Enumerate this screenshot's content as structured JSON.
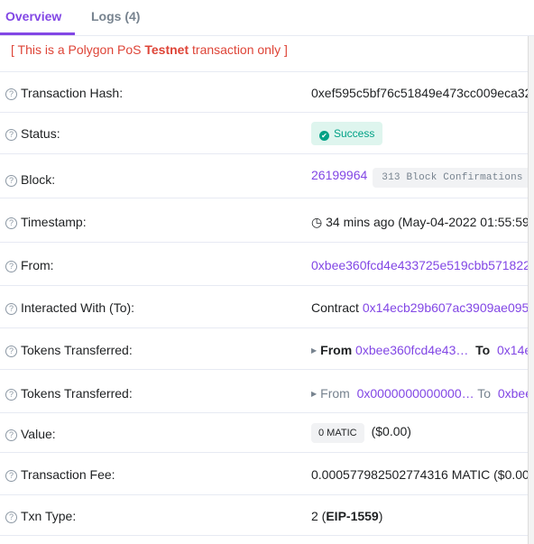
{
  "tabs": {
    "overview": "Overview",
    "logs": "Logs (4)"
  },
  "banner": {
    "prefix": "[ This is a Polygon PoS ",
    "bold": "Testnet",
    "suffix": " transaction only ]"
  },
  "help_glyph": "?",
  "rows": {
    "hash": {
      "label": "Transaction Hash:",
      "value": "0xef595c5bf76c51849e473cc009eca32"
    },
    "status": {
      "label": "Status:",
      "value": "Success"
    },
    "block": {
      "label": "Block:",
      "number": "26199964",
      "confirmations": "313 Block Confirmations"
    },
    "timestamp": {
      "label": "Timestamp:",
      "clock": "◷",
      "value": "34 mins ago (May-04-2022 01:55:59"
    },
    "from": {
      "label": "From:",
      "value": "0xbee360fcd4e433725e519cbb571822"
    },
    "to": {
      "label": "Interacted With (To):",
      "prefix": "Contract",
      "value": "0x14ecb29b607ac3909ae095"
    },
    "tokens1": {
      "label": "Tokens Transferred:",
      "from_label": "From",
      "from_value": "0xbee360fcd4e43…",
      "to_label": "To",
      "to_value": "0x14e"
    },
    "tokens2": {
      "label": "Tokens Transferred:",
      "from_label": "From",
      "from_value": "0x0000000000000…",
      "to_label": "To",
      "to_value": "0xbee"
    },
    "value": {
      "label": "Value:",
      "badge": "0 MATIC",
      "usd": "($0.00)"
    },
    "fee": {
      "label": "Transaction Fee:",
      "value": "0.000577982502774316 MATIC ($0.00"
    },
    "txtype": {
      "label": "Txn Type:",
      "prefix": "2 (",
      "bold": "EIP-1559",
      "suffix": ")"
    }
  },
  "colors": {
    "accent": "#8247e5",
    "error": "#de4437",
    "success": "#00a186",
    "success_bg": "#def5ee"
  }
}
